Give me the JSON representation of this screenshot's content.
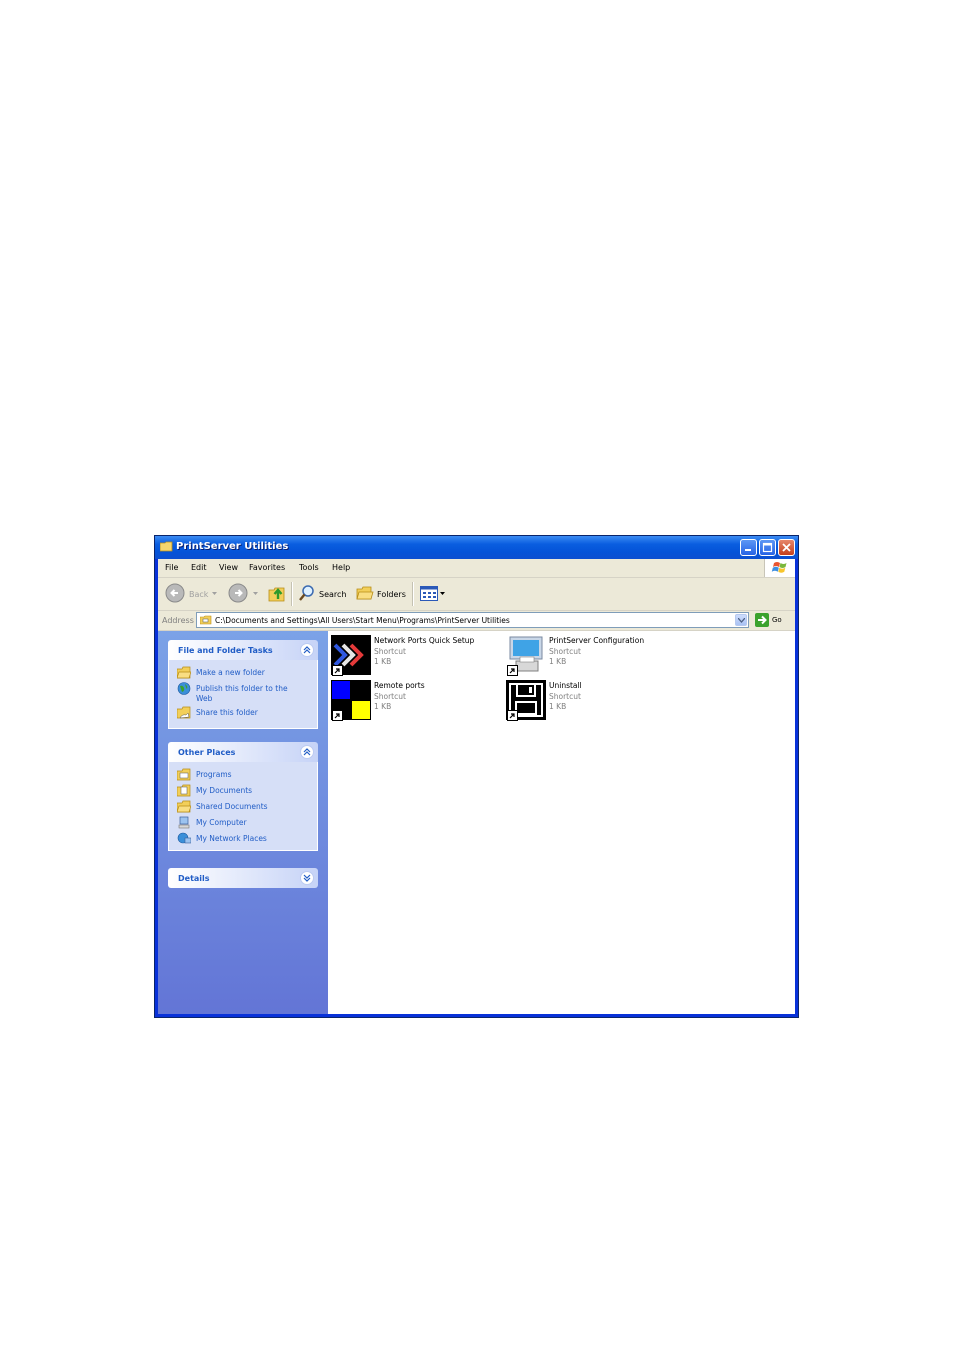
{
  "window": {
    "title": "PrintServer Utilities"
  },
  "menu": [
    "File",
    "Edit",
    "View",
    "Favorites",
    "Tools",
    "Help"
  ],
  "toolbar": {
    "back_label": "Back",
    "search_label": "Search",
    "folders_label": "Folders"
  },
  "address": {
    "label": "Address",
    "path": "C:\\Documents and Settings\\All Users\\Start Menu\\Programs\\PrintServer Utilities",
    "go_label": "Go"
  },
  "tasks": {
    "file_folder": {
      "title": "File and Folder Tasks",
      "items": [
        "Make a new folder",
        "Publish this folder to the Web",
        "Share this folder"
      ]
    },
    "other_places": {
      "title": "Other Places",
      "items": [
        "Programs",
        "My Documents",
        "Shared Documents",
        "My Computer",
        "My Network Places"
      ]
    },
    "details": {
      "title": "Details"
    }
  },
  "files": [
    {
      "name": "Network Ports Quick Setup",
      "type": "Shortcut",
      "size": "1 KB",
      "icon": "network-ports-icon"
    },
    {
      "name": "PrintServer Configuration",
      "type": "Shortcut",
      "size": "1 KB",
      "icon": "printserver-config-icon"
    },
    {
      "name": "Remote ports",
      "type": "Shortcut",
      "size": "1 KB",
      "icon": "remote-ports-icon"
    },
    {
      "name": "Uninstall",
      "type": "Shortcut",
      "size": "1 KB",
      "icon": "uninstall-icon"
    }
  ],
  "colors": {
    "titlebar": "#0a5ee0",
    "taskpane": "#7ba2e7",
    "link": "#215dc6"
  }
}
